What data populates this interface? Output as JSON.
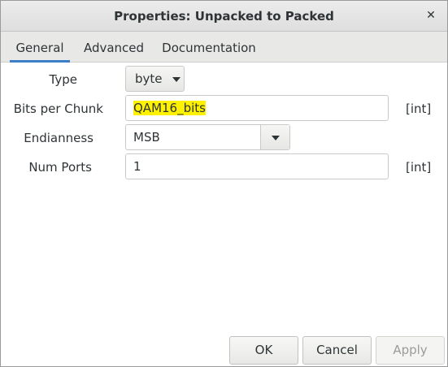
{
  "window": {
    "title": "Properties: Unpacked to Packed"
  },
  "tabs": [
    {
      "label": "General",
      "active": true
    },
    {
      "label": "Advanced",
      "active": false
    },
    {
      "label": "Documentation",
      "active": false
    }
  ],
  "fields": {
    "type": {
      "label": "Type",
      "value": "byte"
    },
    "bits_per_chunk": {
      "label": "Bits per Chunk",
      "value": "QAM16_bits",
      "unit": "[int]"
    },
    "endianness": {
      "label": "Endianness",
      "value": "MSB"
    },
    "num_ports": {
      "label": "Num Ports",
      "value": "1",
      "unit": "[int]"
    }
  },
  "buttons": {
    "ok": "OK",
    "cancel": "Cancel",
    "apply": "Apply"
  },
  "icons": {
    "close": "close-icon",
    "dropdown": "chevron-down-icon"
  },
  "colors": {
    "tab_underline": "#3d7fc7",
    "highlight": "#fff200"
  }
}
